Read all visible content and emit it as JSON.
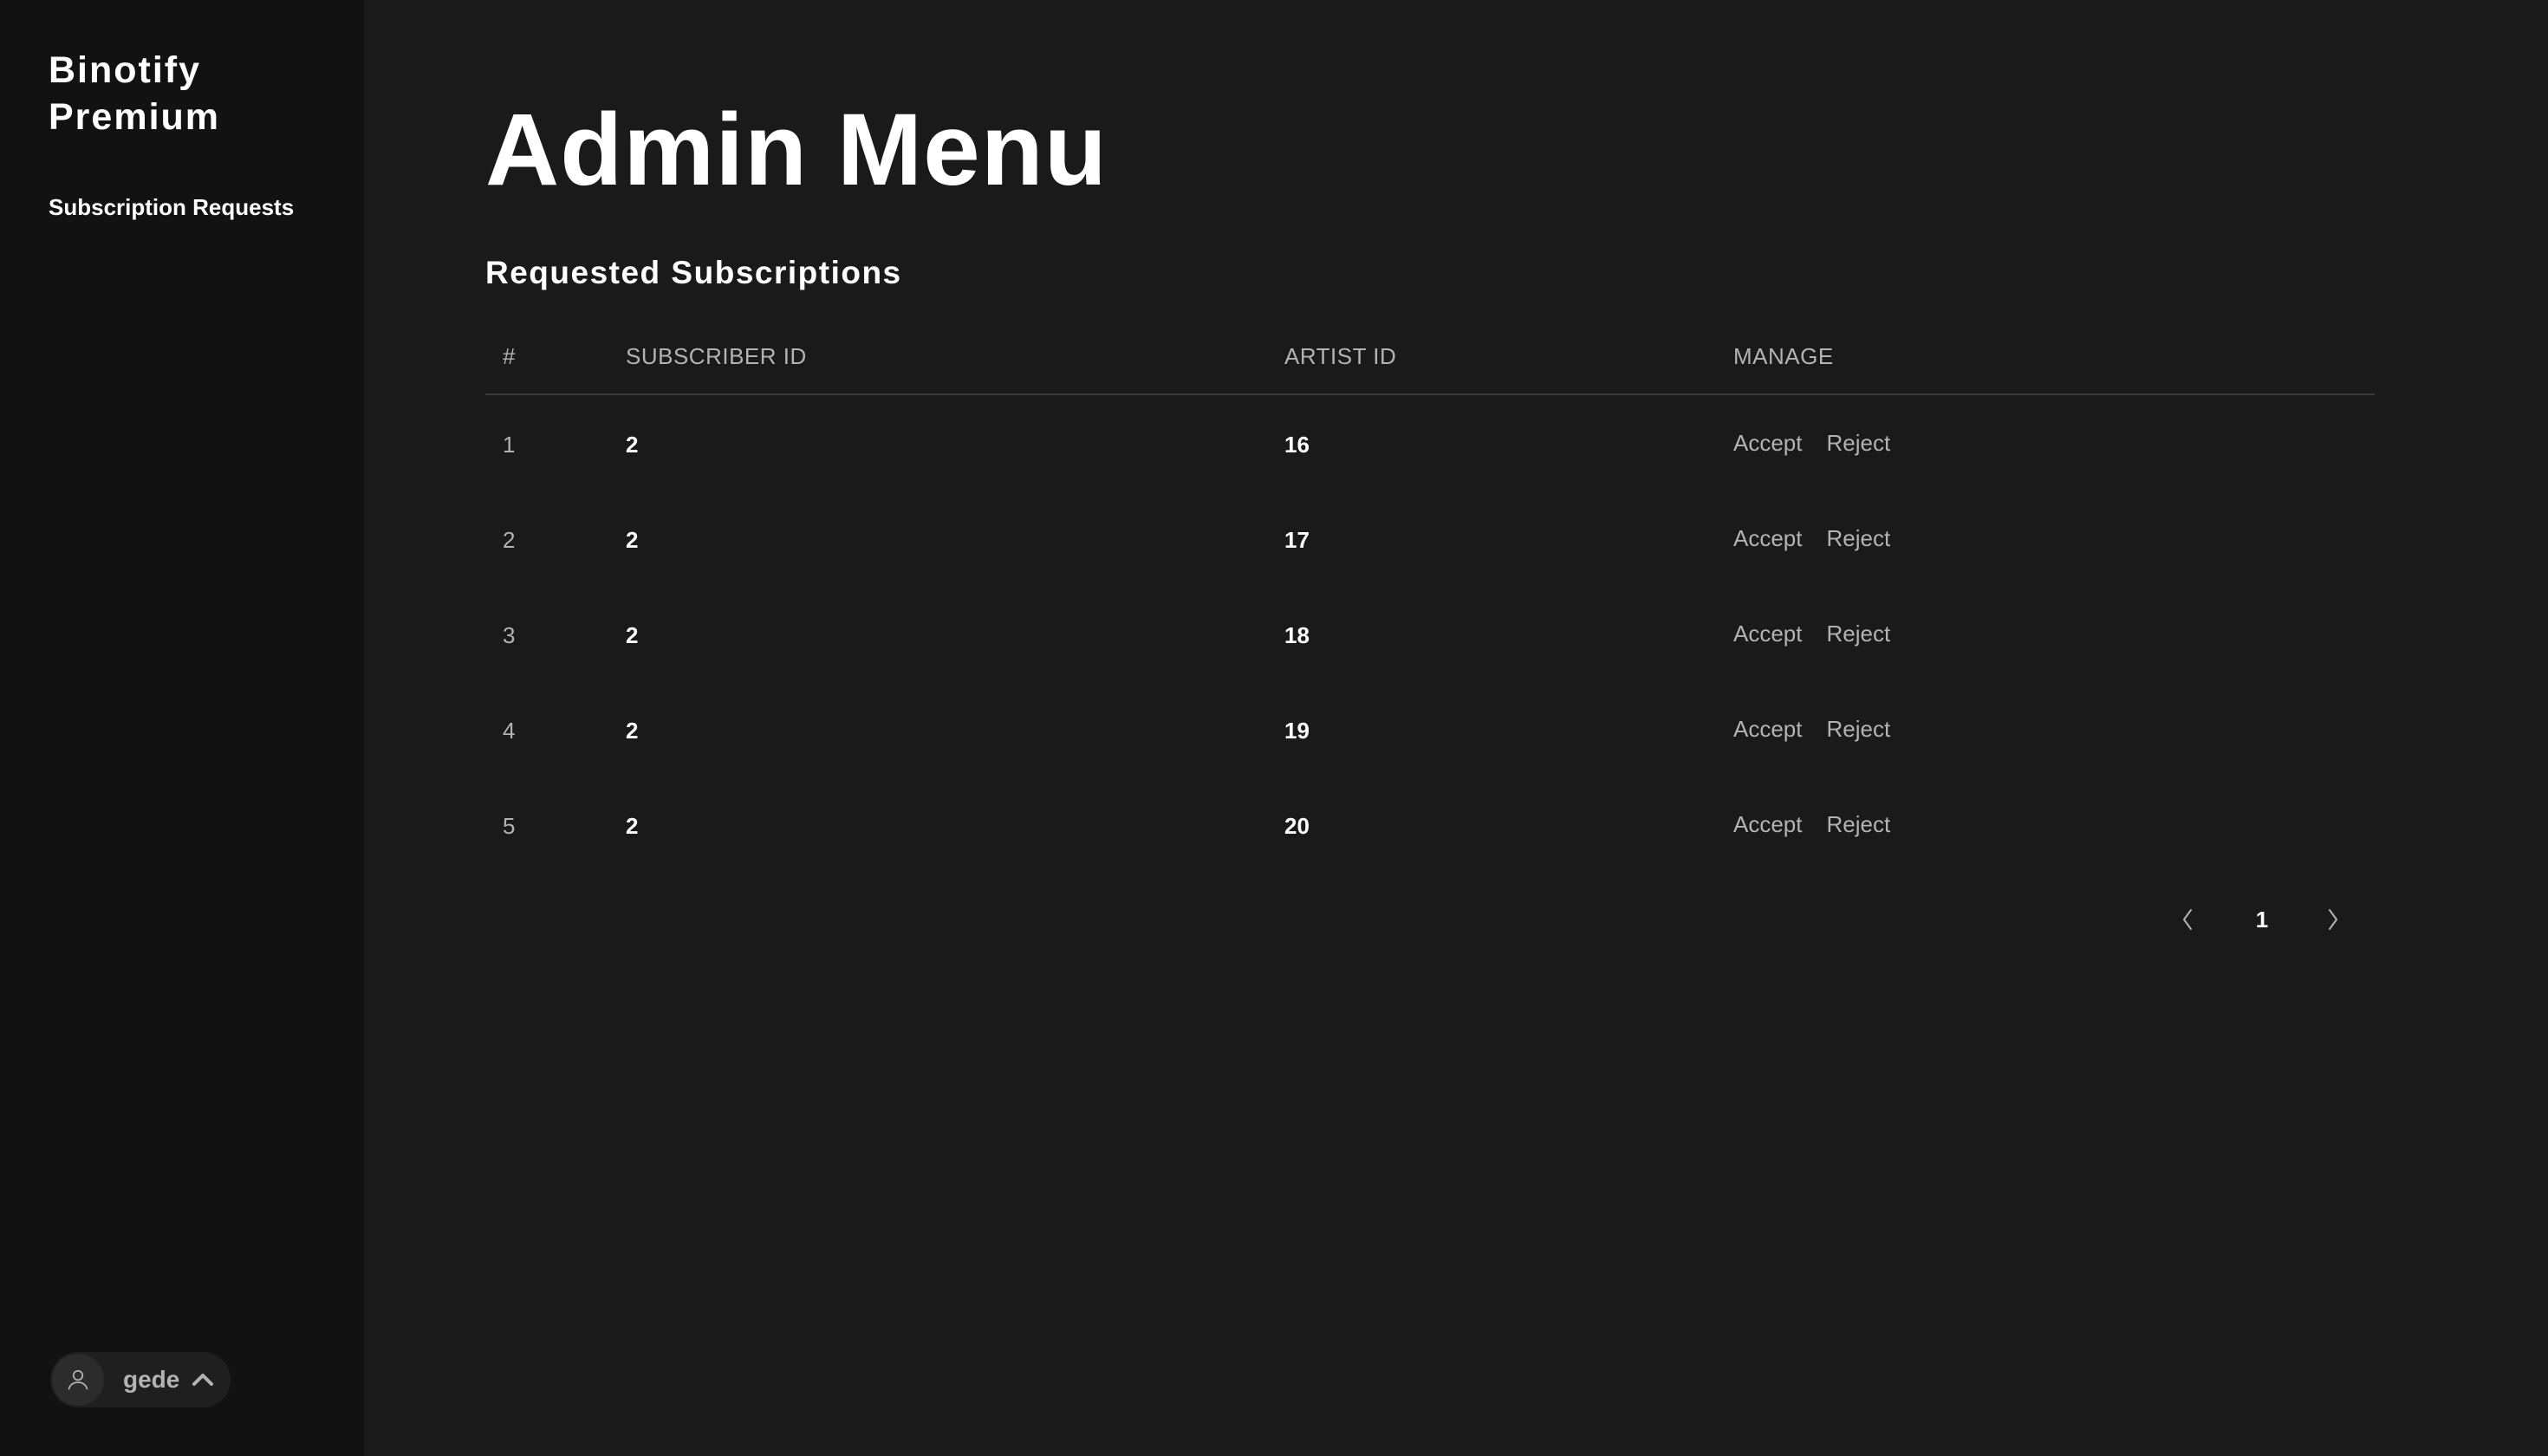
{
  "sidebar": {
    "brand": "Binotify Premium",
    "nav": [
      {
        "label": "Subscription Requests"
      }
    ],
    "user": {
      "name": "gede",
      "avatar_icon": "user-icon",
      "menu_icon": "chevron-up-icon"
    }
  },
  "main": {
    "title": "Admin Menu",
    "section_title": "Requested Subscriptions",
    "table": {
      "headers": {
        "num": "#",
        "subscriber": "SUBSCRIBER ID",
        "artist": "ARTIST ID",
        "manage": "MANAGE"
      },
      "rows": [
        {
          "num": "1",
          "subscriber_id": "2",
          "artist_id": "16",
          "accept": "Accept",
          "reject": "Reject"
        },
        {
          "num": "2",
          "subscriber_id": "2",
          "artist_id": "17",
          "accept": "Accept",
          "reject": "Reject"
        },
        {
          "num": "3",
          "subscriber_id": "2",
          "artist_id": "18",
          "accept": "Accept",
          "reject": "Reject"
        },
        {
          "num": "4",
          "subscriber_id": "2",
          "artist_id": "19",
          "accept": "Accept",
          "reject": "Reject"
        },
        {
          "num": "5",
          "subscriber_id": "2",
          "artist_id": "20",
          "accept": "Accept",
          "reject": "Reject"
        }
      ]
    },
    "pagination": {
      "prev_icon": "chevron-left-icon",
      "current_page": "1",
      "next_icon": "chevron-right-icon"
    }
  },
  "colors": {
    "background": "#1a1a1a",
    "sidebar": "#121212",
    "text_primary": "#ffffff",
    "text_muted": "#b3b3b3"
  }
}
